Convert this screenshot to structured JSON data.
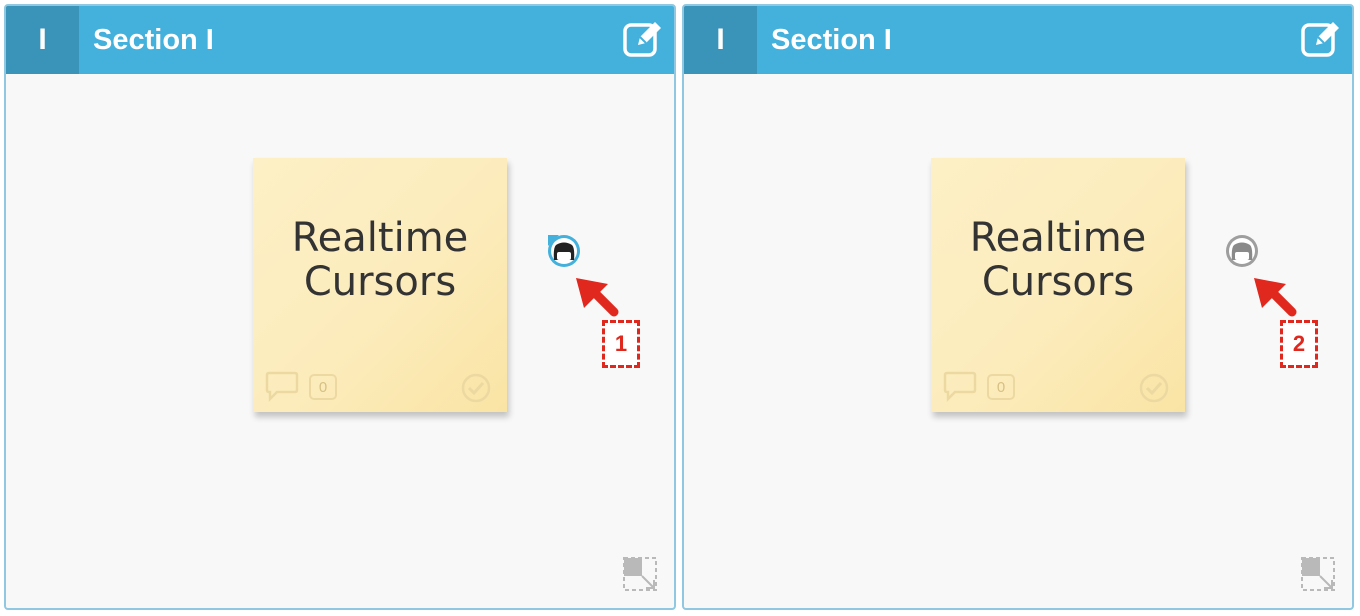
{
  "panels": [
    {
      "section_number": "I",
      "section_title": "Section I",
      "note_text": "Realtime\nCursors",
      "comment_count": "0",
      "callout_number": "1",
      "avatar_state": "active"
    },
    {
      "section_number": "I",
      "section_title": "Section I",
      "note_text": "Realtime\nCursors",
      "comment_count": "0",
      "callout_number": "2",
      "avatar_state": "inactive"
    }
  ],
  "colors": {
    "header": "#44b0dc",
    "header_dark": "#3a93b8",
    "sticky": "#fcecbc",
    "callout": "#e0281e",
    "avatar_active": "#44b0dc",
    "avatar_inactive": "#9e9e9e"
  },
  "icons": [
    "edit-icon",
    "comment-icon",
    "check-circle-icon",
    "user-avatar-icon",
    "resize-icon",
    "arrow-icon"
  ]
}
